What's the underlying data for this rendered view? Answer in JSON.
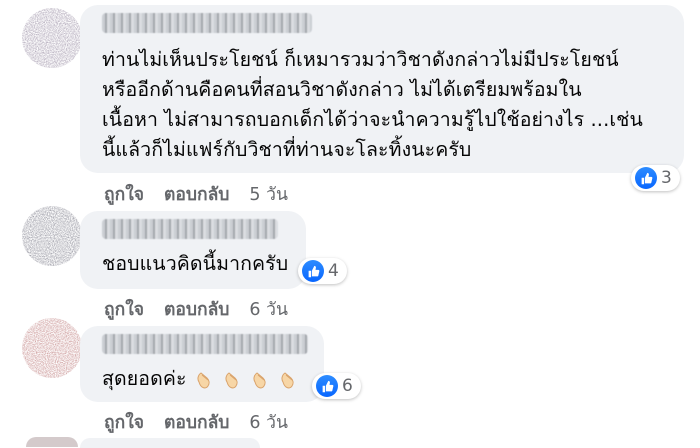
{
  "comments": [
    {
      "text": "ท่านไม่เห็นประโยชน์ ก็เหมารวมว่าวิชาดังกล่าวไม่มีประโยชน์\nหรืออีกด้านคือคนที่สอนวิชาดังกล่าว ไม่ได้เตรียมพร้อมใน\nเนื้อหา ไม่สามารถบอกเด็กได้ว่าจะนำความรู้ไปใช้อย่างไร ...เช่น\nนี้แล้วก็ไม่แฟร์กับวิชาที่ท่านจะโละทิ้งนะครับ",
      "reactions": "3",
      "like_label": "ถูกใจ",
      "reply_label": "ตอบกลับ",
      "time": "5 วัน"
    },
    {
      "text": "ชอบแนวคิดนี้มากครับ",
      "reactions": "4",
      "like_label": "ถูกใจ",
      "reply_label": "ตอบกลับ",
      "time": "6 วัน"
    },
    {
      "text": "สุดยอดค่ะ",
      "emoji": [
        "clapping-hands-emoji",
        "clapping-hands-emoji",
        "clapping-hands-emoji",
        "clapping-hands-emoji"
      ],
      "reactions": "6",
      "like_label": "ถูกใจ",
      "reply_label": "ตอบกลับ",
      "time": "6 วัน"
    }
  ],
  "colors": {
    "bubble": "#f0f2f5",
    "like_blue": "#0866ff",
    "secondary_text": "#65676b"
  }
}
